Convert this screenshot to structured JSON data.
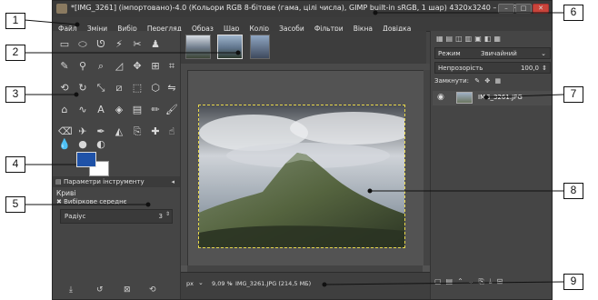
{
  "window": {
    "title": "*[IMG_3261] (імпортовано)-4.0 (Кольори RGB 8-бітове (гама, цілі числа), GIMP built-in sRGB, 1 шар) 4320x3240 – GIMP",
    "minimize_label": "–",
    "maximize_label": "□",
    "close_label": "✕"
  },
  "menubar": {
    "items": [
      "Файл",
      "Зміни",
      "Вибір",
      "Перегляд",
      "Образ",
      "Шар",
      "Колір",
      "Засоби",
      "Фільтри",
      "Вікна",
      "Довідка"
    ]
  },
  "tool_options": {
    "tab_label": "Параметри інструменту",
    "tool_name": "Криві",
    "checkbox_label": "Вибіркове середнє",
    "radius_label": "Радіус",
    "radius_value": "3"
  },
  "statusbar": {
    "unit": "px",
    "zoom": "9,09 %",
    "info": "IMG_3261.JPG (214,5 МБ)"
  },
  "layers": {
    "mode_label": "Режим",
    "mode_value": "Звичайний",
    "opacity_label": "Непрозорість",
    "opacity_value": "100,0",
    "lock_label": "Замкнути:",
    "layer_name": "IMG_3261.JPG"
  },
  "callouts": [
    "1",
    "2",
    "3",
    "4",
    "5",
    "6",
    "7",
    "8",
    "9"
  ],
  "colors": {
    "foreground": "#1f52a8",
    "background": "#ffffff",
    "canvas_bg": "#535353",
    "panel_bg": "#454545"
  }
}
